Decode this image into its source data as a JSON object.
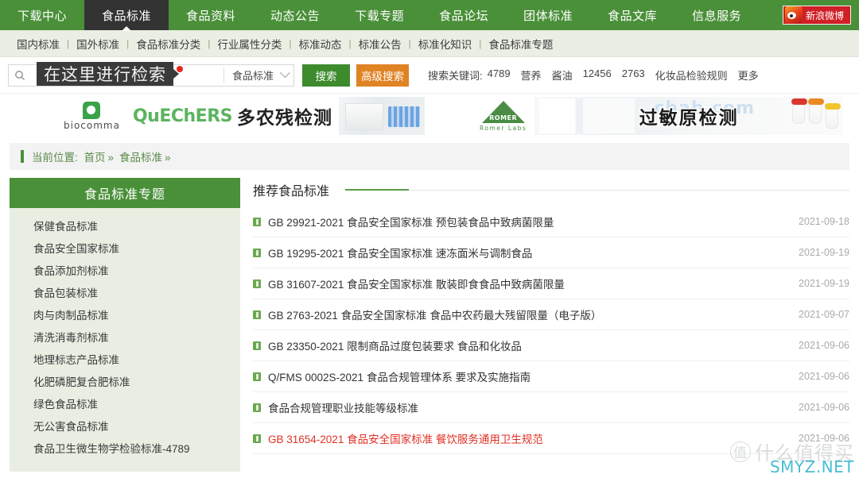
{
  "topnav": {
    "items": [
      {
        "label": "下载中心",
        "active": false
      },
      {
        "label": "食品标准",
        "active": true
      },
      {
        "label": "食品资料",
        "active": false
      },
      {
        "label": "动态公告",
        "active": false
      },
      {
        "label": "下载专题",
        "active": false
      },
      {
        "label": "食品论坛",
        "active": false
      },
      {
        "label": "团体标准",
        "active": false
      },
      {
        "label": "食品文库",
        "active": false
      },
      {
        "label": "信息服务",
        "active": false
      }
    ],
    "weibo_label": "新浪微博"
  },
  "subnav": {
    "items": [
      "国内标准",
      "国外标准",
      "食品标准分类",
      "行业属性分类",
      "标准动态",
      "标准公告",
      "标准化知识",
      "食品标准专题"
    ],
    "separator": "|"
  },
  "search": {
    "value": "",
    "placeholder": "",
    "tooltip": "在这里进行检索",
    "category": "食品标准",
    "search_button": "搜索",
    "advanced_button": "高级搜索",
    "keywords_label": "搜索关键词:",
    "keywords": [
      "4789",
      "营养",
      "酱油",
      "12456",
      "2763",
      "化妆品检验规则",
      "更多"
    ]
  },
  "banners": {
    "left": {
      "brand": "biocomma",
      "title_en": "QuEChERS",
      "title_cn": "多农残检测"
    },
    "right": {
      "brand": "ROMER",
      "brand_sub": "Romer Labs",
      "title_cn": "过敏原检测",
      "ghost_text": "chab.com"
    }
  },
  "breadcrumb": {
    "label": "当前位置:",
    "items": [
      "首页",
      "食品标准"
    ],
    "separator": "»"
  },
  "sidebar": {
    "title": "食品标准专题",
    "items": [
      "保健食品标准",
      "食品安全国家标准",
      "食品添加剂标准",
      "食品包装标准",
      "肉与肉制品标准",
      "清洗消毒剂标准",
      "地理标志产品标准",
      "化肥磷肥复合肥标准",
      "绿色食品标准",
      "无公害食品标准",
      "食品卫生微生物学检验标准-4789"
    ]
  },
  "main": {
    "title": "推荐食品标准",
    "items": [
      {
        "name": "GB 29921-2021 食品安全国家标准 预包装食品中致病菌限量",
        "date": "2021-09-18",
        "highlight": false
      },
      {
        "name": "GB 19295-2021 食品安全国家标准 速冻面米与调制食品",
        "date": "2021-09-19",
        "highlight": false
      },
      {
        "name": "GB 31607-2021 食品安全国家标准 散装即食食品中致病菌限量",
        "date": "2021-09-19",
        "highlight": false
      },
      {
        "name": "GB 2763-2021 食品安全国家标准 食品中农药最大残留限量（电子版）",
        "date": "2021-09-07",
        "highlight": false
      },
      {
        "name": "GB 23350-2021 限制商品过度包装要求 食品和化妆品",
        "date": "2021-09-06",
        "highlight": false
      },
      {
        "name": "Q/FMS 0002S-2021 食品合规管理体系 要求及实施指南",
        "date": "2021-09-06",
        "highlight": false
      },
      {
        "name": "食品合规管理职业技能等级标准",
        "date": "2021-09-06",
        "highlight": false
      },
      {
        "name": "GB 31654-2021 食品安全国家标准 餐饮服务通用卫生规范",
        "date": "2021-09-06",
        "highlight": true
      }
    ]
  },
  "watermark": {
    "mark": "值",
    "text": "什么值得买",
    "url": "SMYZ.NET"
  },
  "colors": {
    "brand_green": "#4a9039",
    "active_tab": "#333333",
    "search_button": "#3d8b2d",
    "advanced_button": "#e08324",
    "weibo_red": "#d01f26",
    "highlight_red": "#e03024",
    "watermark_cyan": "#35b6d1"
  }
}
